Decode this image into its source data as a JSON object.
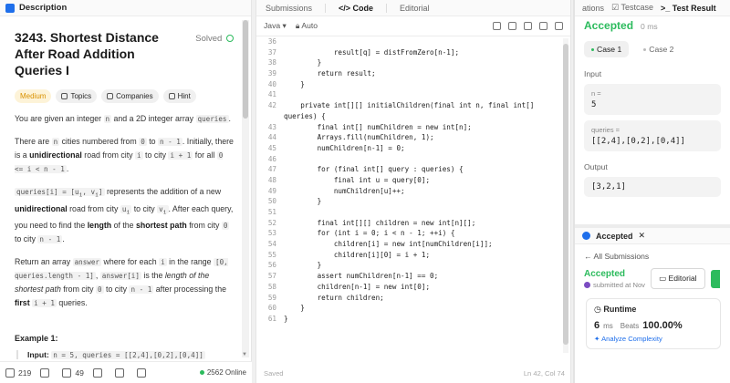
{
  "description": {
    "tab_label": "Description",
    "title": "3243. Shortest Distance After Road Addition Queries I",
    "solved_label": "Solved",
    "chips": [
      "Medium",
      "Topics",
      "Companies",
      "Hint"
    ],
    "p1": [
      "You are given an integer ",
      "n",
      " and a 2D integer array ",
      "queries",
      "."
    ],
    "p2": [
      "There are ",
      "n",
      " cities numbered from ",
      "0",
      " to ",
      "n - 1",
      ". Initially, there is a ",
      "unidirectional",
      " road from city ",
      "i",
      " to city ",
      "i + 1",
      " for all ",
      "0 <= i < n - 1",
      "."
    ],
    "p3": [
      "queries[i] = [u",
      "i",
      ", v",
      "i",
      "]",
      " represents the addition of a new ",
      "unidirectional",
      " road from city ",
      "u",
      "i",
      " to city ",
      "v",
      "i",
      ". After each query, you need to find the ",
      "length",
      " of the ",
      "shortest path",
      " from city ",
      "0",
      " to city ",
      "n - 1",
      "."
    ],
    "p4": [
      "Return an array ",
      "answer",
      " where for each ",
      "i",
      " in the range ",
      "[0, queries.length - 1]",
      ", ",
      "answer[i]",
      " is the ",
      "length of the shortest path",
      " from city ",
      "0",
      " to city ",
      "n - 1",
      " after processing the ",
      "first",
      " ",
      "i + 1",
      " queries."
    ],
    "example_title": "Example 1:",
    "example_input_label": "Input:",
    "example_input": "n = 5, queries = [[2,4],[0,2],[0,4]]",
    "footer": {
      "likes": "219",
      "comments": "49",
      "online": "2562 Online"
    }
  },
  "editor": {
    "tabs": [
      "Submissions",
      "Code",
      "Editorial"
    ],
    "language": "Java",
    "mode": "Auto",
    "status_left": "Saved",
    "status_right": "Ln 42, Col 74",
    "lines": [
      {
        "n": "36",
        "t": "                    "
      },
      {
        "n": "37",
        "t": "            result[q] = distFromZero[n-1];"
      },
      {
        "n": "38",
        "t": "        }"
      },
      {
        "n": "39",
        "t": "        return result;"
      },
      {
        "n": "40",
        "t": "    }"
      },
      {
        "n": "41",
        "t": ""
      },
      {
        "n": "42",
        "t": "    private int[][] initialChildren(final int n, final int[]"
      },
      {
        "n": "",
        "t": "queries) {"
      },
      {
        "n": "43",
        "t": "        final int[] numChildren = new int[n];"
      },
      {
        "n": "44",
        "t": "        Arrays.fill(numChildren, 1);"
      },
      {
        "n": "45",
        "t": "        numChildren[n-1] = 0;"
      },
      {
        "n": "46",
        "t": ""
      },
      {
        "n": "47",
        "t": "        for (final int[] query : queries) {"
      },
      {
        "n": "48",
        "t": "            final int u = query[0];"
      },
      {
        "n": "49",
        "t": "            numChildren[u]++;"
      },
      {
        "n": "50",
        "t": "        }"
      },
      {
        "n": "51",
        "t": ""
      },
      {
        "n": "52",
        "t": "        final int[][] children = new int[n][];"
      },
      {
        "n": "53",
        "t": "        for (int i = 0; i < n - 1; ++i) {"
      },
      {
        "n": "54",
        "t": "            children[i] = new int[numChildren[i]];"
      },
      {
        "n": "55",
        "t": "            children[i][0] = i + 1;"
      },
      {
        "n": "56",
        "t": "        }"
      },
      {
        "n": "57",
        "t": "        assert numChildren[n-1] == 0;"
      },
      {
        "n": "58",
        "t": "        children[n-1] = new int[0];"
      },
      {
        "n": "59",
        "t": "        return children;"
      },
      {
        "n": "60",
        "t": "    }"
      },
      {
        "n": "61",
        "t": "}"
      }
    ]
  },
  "testcase": {
    "tabs": [
      "ations",
      "Testcase",
      "Test Result"
    ],
    "status": "Accepted",
    "runtime": "0 ms",
    "cases": [
      "Case 1",
      "Case 2"
    ],
    "input_label": "Input",
    "n_label": "n =",
    "n_value": "5",
    "queries_label": "queries =",
    "queries_value": "[[2,4],[0,2],[0,4]]",
    "output_label": "Output",
    "output_value": "[3,2,1]"
  },
  "submission": {
    "tab_label": "Accepted",
    "back_label": "All Submissions",
    "status": "Accepted",
    "submitted": "submitted at Nov",
    "editorial_btn": "Editorial",
    "runtime_label": "Runtime",
    "runtime_value": "6",
    "runtime_unit": "ms",
    "beats_label": "Beats",
    "beats_value": "100.00%",
    "analyze": "Analyze Complexity"
  }
}
